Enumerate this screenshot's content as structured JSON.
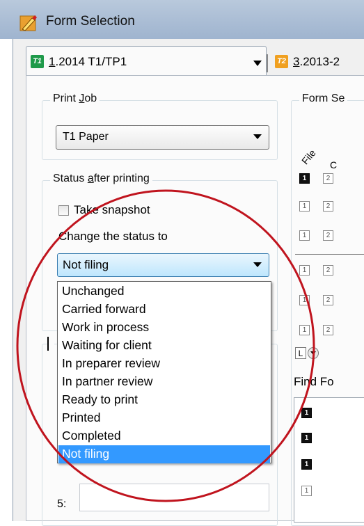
{
  "window": {
    "title": "Form Selection"
  },
  "tabs": [
    {
      "badge": "T1",
      "label": "1.2014 T1/TP1",
      "badge_color": "#1f9a4a"
    },
    {
      "badge": "T2",
      "label": "3.2013-2",
      "badge_color": "#f0a020"
    }
  ],
  "print_job": {
    "legend": "Print Job",
    "value": "T1 Paper"
  },
  "status_after_printing": {
    "legend": "Status after printing",
    "take_snapshot_label": "Take snapshot",
    "take_snapshot_checked": false,
    "change_status_label": "Change the status to",
    "selected_value": "Not filing"
  },
  "status_options": [
    "Unchanged",
    "Carried forward",
    "Work in process",
    "Waiting for client",
    "In preparer review",
    "In partner review",
    "Ready to print",
    "Printed",
    "Completed",
    "Not filing"
  ],
  "highlighted_option": "Not filing",
  "lower_group": {
    "row_label": "5:"
  },
  "form_selection": {
    "legend": "Form Se",
    "column_header_file": "File",
    "column_header_other": "C",
    "rows": [
      "1",
      "1",
      "1",
      "1",
      "1",
      "1"
    ],
    "column2_value": "2",
    "small_label": "L"
  },
  "find_forms": {
    "label": "Find Fo",
    "rows": [
      "1",
      "1",
      "1",
      "1"
    ]
  },
  "colors": {
    "selection_blue": "#3399ff",
    "annotation_red": "#c0141e",
    "title_bar": "#b3c5da"
  }
}
